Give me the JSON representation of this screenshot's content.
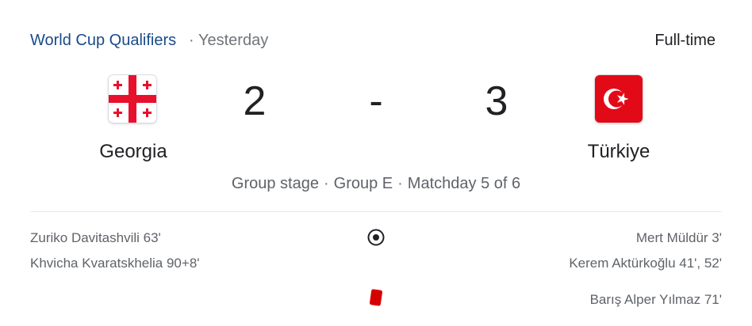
{
  "header": {
    "competition": "World Cup Qualifiers",
    "separator": "·",
    "when": "Yesterday",
    "status": "Full-time"
  },
  "home": {
    "name": "Georgia",
    "score": "2",
    "flag_icon": "georgia-flag-icon",
    "flag_colors": {
      "field": "#ffffff",
      "cross": "#e8112d"
    }
  },
  "away": {
    "name": "Türkiye",
    "score": "3",
    "flag_icon": "turkey-flag-icon",
    "flag_colors": {
      "field": "#e30a17",
      "crescent_star": "#ffffff"
    }
  },
  "score_separator": "-",
  "stage": {
    "parts": [
      "Group stage",
      "Group E",
      "Matchday 5 of 6"
    ],
    "separator": "·"
  },
  "events": {
    "goals_icon": "soccer-ball-icon",
    "red_card_icon": "red-card-icon",
    "red_card_color": "#d50000",
    "home_goals": [
      "Zuriko Davitashvili 63'",
      "Khvicha Kvaratskhelia 90+8'"
    ],
    "away_goals": [
      "Mert Müldür 3'",
      "Kerem Aktürkoğlu 41', 52'"
    ],
    "away_red_cards": [
      "Barış Alper Yılmaz 71'"
    ]
  }
}
